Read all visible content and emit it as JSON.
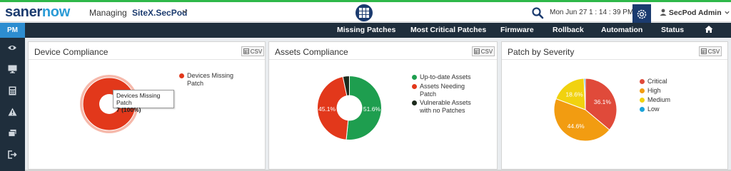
{
  "brand": {
    "part1": "saner",
    "part2": "now"
  },
  "header": {
    "managing_label": "Managing",
    "site_name": "SiteX.SecPod",
    "datetime": "Mon Jun 27  1 : 14 : 39 PM",
    "user_name": "SecPod Admin"
  },
  "nav": {
    "items": [
      "Missing Patches",
      "Most Critical Patches",
      "Firmware",
      "Rollback",
      "Automation",
      "Status"
    ]
  },
  "sidebar": {
    "module": "PM",
    "icons": [
      "eye-icon",
      "monitor-icon",
      "calculator-icon",
      "warning-icon",
      "layers-icon",
      "logout-icon"
    ]
  },
  "colors": {
    "brand_dark": "#1b3b6f",
    "brand_light": "#2a9bd6",
    "nav_bg": "#1f2e3c",
    "accent_green": "#2fb84a",
    "pm_blue": "#2d8dd0"
  },
  "cards": [
    {
      "title": "Device Compliance",
      "csv_label": "CSV",
      "legend": [
        "Devices Missing Patch"
      ],
      "tooltip": {
        "label": "Devices Missing Patch",
        "value": "7 (100%)"
      }
    },
    {
      "title": "Assets Compliance",
      "csv_label": "CSV",
      "legend": [
        "Up-to-date Assets",
        "Assets Needing Patch",
        "Vulnerable Assets with no Patches"
      ]
    },
    {
      "title": "Patch by Severity",
      "csv_label": "CSV",
      "legend": [
        "Critical",
        "High",
        "Medium",
        "Low"
      ]
    }
  ],
  "chart_data": [
    {
      "type": "pie",
      "categories": [
        "Devices Missing Patch"
      ],
      "values": [
        100
      ],
      "colors": [
        "#e2381b"
      ]
    },
    {
      "type": "pie",
      "categories": [
        "Up-to-date Assets",
        "Assets Needing Patch",
        "Vulnerable Assets with no Patches"
      ],
      "values": [
        51.6,
        45.1,
        3.3
      ],
      "labels": [
        "51.6%",
        "45.1%",
        ""
      ],
      "colors": [
        "#1e9e4f",
        "#e2381b",
        "#1c2a1c"
      ]
    },
    {
      "type": "pie",
      "categories": [
        "Critical",
        "High",
        "Medium",
        "Low"
      ],
      "values": [
        36.1,
        44.6,
        18.6,
        0.7
      ],
      "labels": [
        "36.1%",
        "44.6%",
        "18.6%",
        ""
      ],
      "colors": [
        "#e04a3a",
        "#f29c11",
        "#f1d20f",
        "#1aa3d9"
      ]
    }
  ]
}
